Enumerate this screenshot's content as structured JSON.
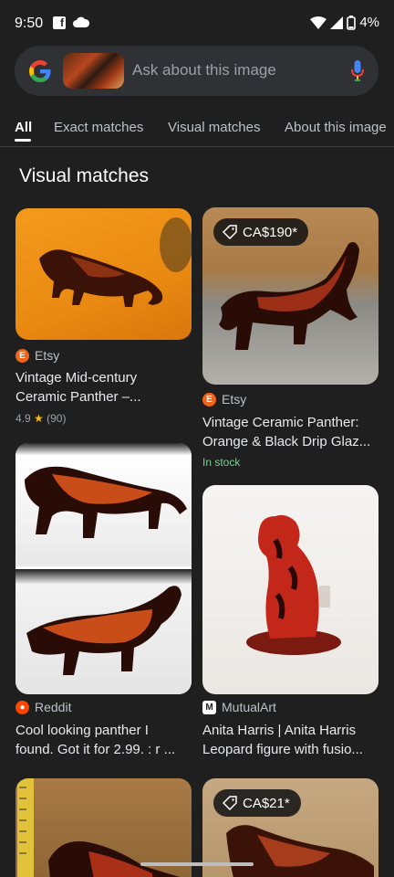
{
  "status_bar": {
    "time": "9:50",
    "battery": "4%"
  },
  "search": {
    "placeholder": "Ask about this image"
  },
  "tabs": [
    {
      "label": "All",
      "active": true
    },
    {
      "label": "Exact matches"
    },
    {
      "label": "Visual matches"
    },
    {
      "label": "About this image"
    }
  ],
  "section_title": "Visual matches",
  "results": [
    {
      "source": "Etsy",
      "title_line1": "Vintage Mid-century",
      "title_line2": "Ceramic Panther –...",
      "rating": "4.9",
      "reviews": "(90)"
    },
    {
      "price": "CA$190*",
      "source": "Etsy",
      "title_line1": "Vintage Ceramic Panther:",
      "title_line2": "Orange & Black Drip Glaz...",
      "stock": "In stock"
    },
    {
      "source": "Reddit",
      "title_line1": "Cool looking panther I",
      "title_line2": "found. Got it for 2.99. : r ..."
    },
    {
      "source": "MutualArt",
      "title_line1": "Anita Harris | Anita Harris",
      "title_line2": "Leopard figure with fusio..."
    },
    {},
    {
      "price": "CA$21*"
    }
  ],
  "colors": {
    "background": "#1f1f1f",
    "search_bg": "#303134",
    "stock_green": "#81c995",
    "etsy_orange": "#f1641e",
    "reddit_orange": "#ff4500"
  }
}
